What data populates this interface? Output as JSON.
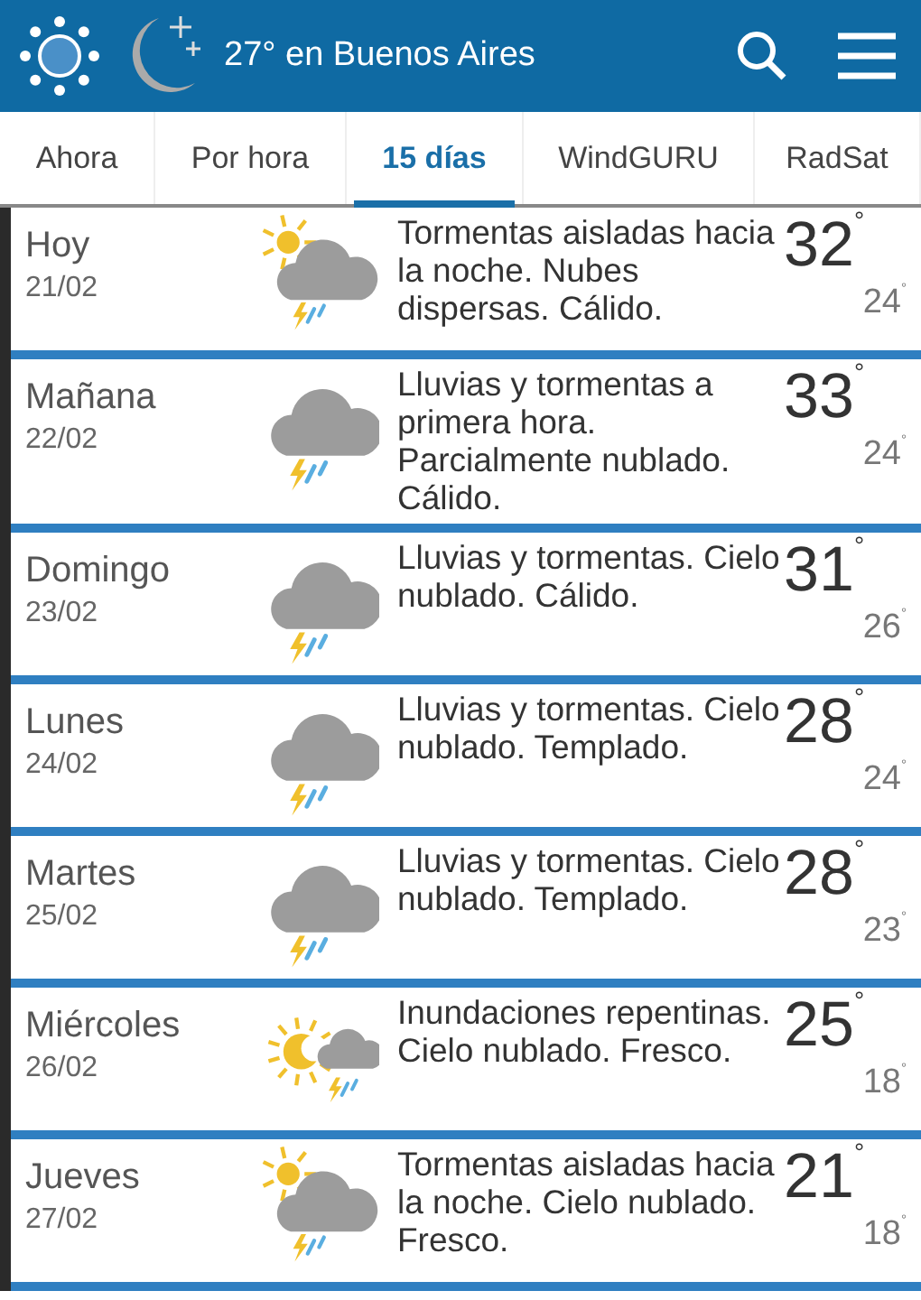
{
  "header": {
    "title": "27° en Buenos Aires"
  },
  "tabs": [
    {
      "label": "Ahora",
      "selected": false
    },
    {
      "label": "Por hora",
      "selected": false
    },
    {
      "label": "15 días",
      "selected": true
    },
    {
      "label": "WindGURU",
      "selected": false
    },
    {
      "label": "RadSat",
      "selected": false
    }
  ],
  "days": [
    {
      "day": "Hoy",
      "date": "21/02",
      "kind": "sun-cloud-storm",
      "description": "Tormentas aisladas hacia la noche. Nubes dispersas. Cálido.",
      "high": "32$^{°}$",
      "low": "24$^{°}$"
    },
    {
      "day": "Mañana",
      "date": "22/02",
      "kind": "cloud-storm",
      "description": "Lluvias y tormentas a primera hora. Parcialmente nublado. Cálido.",
      "high": "33$^{°}$",
      "low": "24$^{°}$"
    },
    {
      "day": "Domingo",
      "date": "23/02",
      "kind": "cloud-storm",
      "description": "Lluvias y tormentas. Cielo nublado. Cálido.",
      "high": "31$^{°}$",
      "low": "26$^{°}$"
    },
    {
      "day": "Lunes",
      "date": "24/02",
      "kind": "cloud-storm",
      "description": "Lluvias y tormentas. Cielo nublado. Templado.",
      "high": "28$^{°}$",
      "low": "24$^{°}$"
    },
    {
      "day": "Martes",
      "date": "25/02",
      "kind": "cloud-storm",
      "description": "Lluvias y tormentas. Cielo nublado. Templado.",
      "high": "28$^{°}$",
      "low": "23$^{°}$"
    },
    {
      "day": "Miércoles",
      "date": "26/02",
      "kind": "sun-moon-storm",
      "description": "Inundaciones repentinas. Cielo nublado. Fresco.",
      "high": "25$^{°}$",
      "low": "18$^{°}$"
    },
    {
      "day": "Jueves",
      "date": "27/02",
      "kind": "sun-cloud-storm",
      "description": "Tormentas aisladas hacia la noche. Cielo nublado. Fresco.",
      "high": "21$^{°}$",
      "low": "18$^{°}$"
    }
  ]
}
